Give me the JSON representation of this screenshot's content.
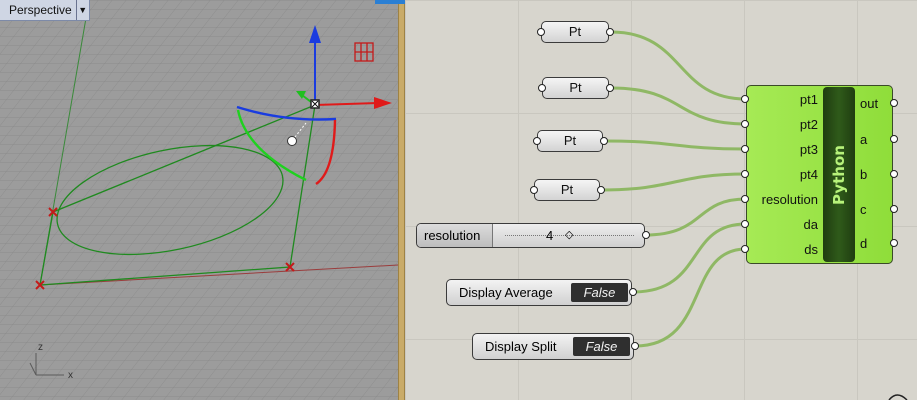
{
  "viewport": {
    "label": "Perspective",
    "axis_z": "z",
    "axis_x": "x"
  },
  "canvas": {
    "pt_nodes": [
      {
        "label": "Pt"
      },
      {
        "label": "Pt"
      },
      {
        "label": "Pt"
      },
      {
        "label": "Pt"
      }
    ],
    "slider": {
      "name": "resolution",
      "value": "4"
    },
    "toggles": [
      {
        "label": "Display Average",
        "value": "False"
      },
      {
        "label": "Display Split",
        "value": "False"
      }
    ],
    "python": {
      "title": "Python",
      "inputs": [
        "pt1",
        "pt2",
        "pt3",
        "pt4",
        "resolution",
        "da",
        "ds"
      ],
      "outputs": [
        "out",
        "a",
        "b",
        "c",
        "d"
      ]
    }
  },
  "colors": {
    "wire": "#8fb865",
    "component_fill": "#9be348",
    "divider": "#c9ab68"
  }
}
